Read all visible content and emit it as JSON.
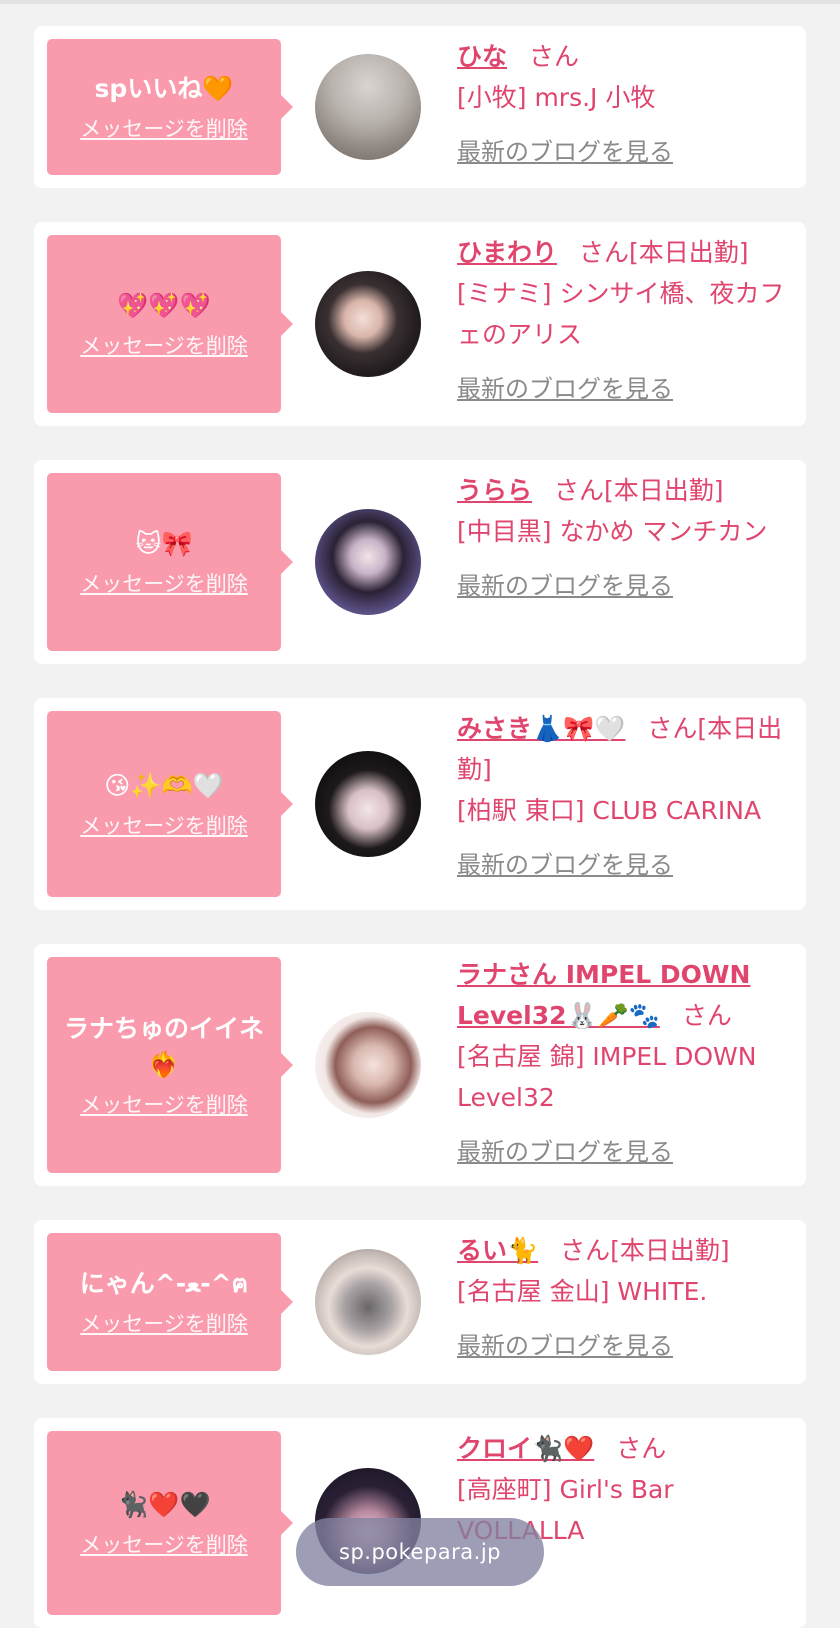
{
  "app": {
    "url": "sp.pokepara.jp"
  },
  "delete_label": "メッセージを削除",
  "san_label": "さん",
  "blog_label": "最新のブログを見る",
  "colors": {
    "accent": "#e0456e",
    "bubble": "#fa9bad",
    "background": "#f2f2f2",
    "link_gray": "#8a8a8a"
  },
  "cards": [
    {
      "message": "spいいね🧡",
      "name": "ひな",
      "suffix": "",
      "shop": "[小牧] mrs.J 小牧"
    },
    {
      "message": "💖💖💖",
      "name": "ひまわり",
      "suffix": "[本日出勤]",
      "shop": "[ミナミ] シンサイ橋、夜カフェのアリス"
    },
    {
      "message": "🐱🎀",
      "name": "うらら",
      "suffix": "[本日出勤]",
      "shop": "[中目黒] なかめ マンチカン"
    },
    {
      "message": "😘✨🫶🤍",
      "name": "みさき👗🎀🤍",
      "suffix": "[本日出勤]",
      "shop": "[柏駅 東口] CLUB CARINA"
    },
    {
      "message": "ラナちゅのイイネ❤️‍🔥",
      "name": "ラナさん IMPEL DOWN Level32🐰🥕🐾",
      "suffix": "",
      "shop": "[名古屋 錦] IMPEL DOWN Level32"
    },
    {
      "message": "にゃん^-ﻌ-^ฅ",
      "name": "るい🐈",
      "suffix": "[本日出勤]",
      "shop": "[名古屋 金山] WHITE."
    },
    {
      "message": "🐈‍⬛❤️🖤",
      "name": "クロイ🐈‍⬛❤️",
      "suffix": "",
      "shop": "[高座町] Girl's Bar VOLLALLA"
    }
  ]
}
